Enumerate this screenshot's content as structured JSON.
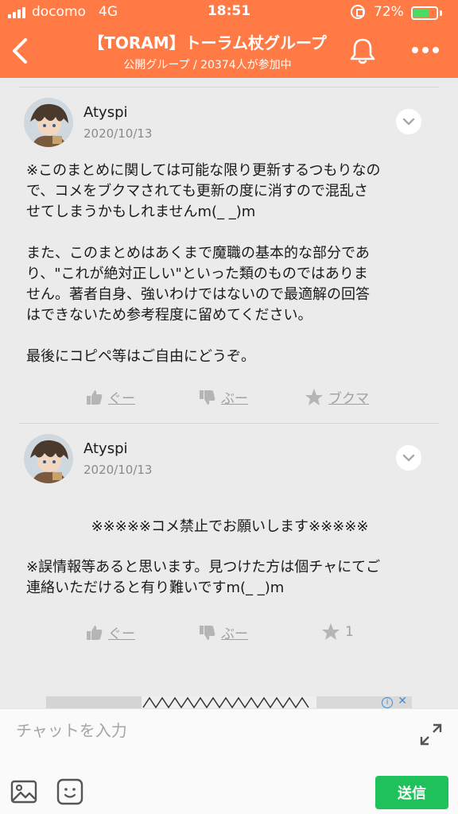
{
  "status_bar": {
    "carrier": "docomo",
    "network": "4G",
    "time": "18:51",
    "battery_pct": "72%",
    "battery_level": 0.72,
    "battery_color": "#4cd964"
  },
  "header": {
    "title": "【TORAM】トーラム杖グループ",
    "subtitle": "公開グループ / 20374人が参加中",
    "background": "#ff7a45",
    "back_icon": "chevron-left-icon",
    "bell_icon": "bell-icon",
    "more_icon": "more-dots-icon"
  },
  "posts": [
    {
      "author": "Atyspi",
      "date": "2020/10/13",
      "paragraphs": [
        "※このまとめに関しては可能な限り更新するつもりなの",
        "で、コメをブクマされても更新の度に消すので混乱さ",
        "せてしまうかもしれませんm(_ _)m",
        "",
        "また、このまとめはあくまで魔職の基本的な部分であ",
        "り、\"これが絶対正しい\"といった類のものではありま",
        "せん。著者自身、強いわけではないので最適解の回答",
        "はできないため参考程度に留めてください。",
        "",
        "最後にコピペ等はご自由にどうぞ。"
      ],
      "actions": {
        "like": "ぐー",
        "dislike": "ぶー",
        "bookmark": "ブクマ"
      }
    },
    {
      "author": "Atyspi",
      "date": "2020/10/13",
      "centered_line": "※※※※※コメ禁止でお願いします※※※※※",
      "paragraphs": [
        "※誤情報等あると思います。見つけた方は個チャにてご",
        "連絡いただけると有り難いですm(_ _)m"
      ],
      "actions": {
        "like": "ぐー",
        "dislike": "ぶー",
        "bookmark_count": "1"
      }
    }
  ],
  "ad": {
    "info_icon": "info-icon",
    "close_icon": "close-icon",
    "info_glyph": "i",
    "close_glyph": "✕"
  },
  "composer": {
    "placeholder": "チャットを入力",
    "send_label": "送信",
    "send_color": "#1ec15a"
  }
}
